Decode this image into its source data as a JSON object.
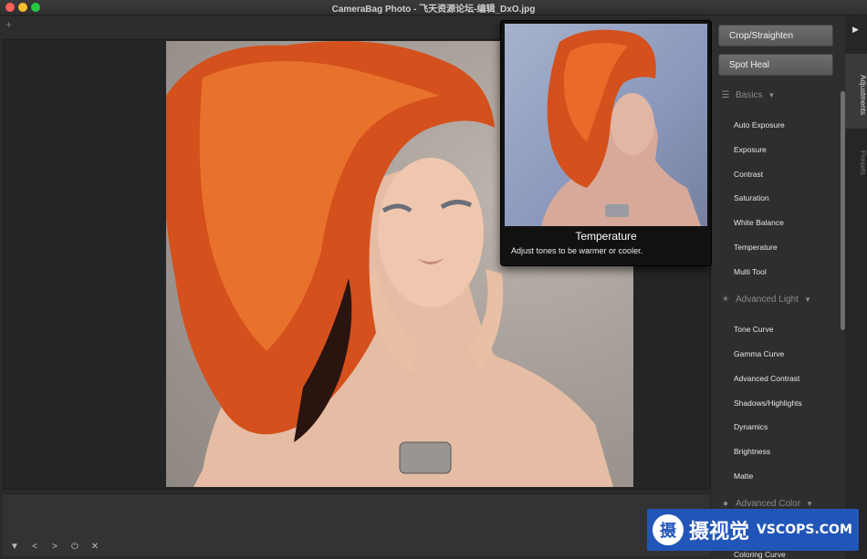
{
  "window": {
    "title": "CameraBag Photo - 飞天资源论坛-编辑_DxO.jpg"
  },
  "toolbar": {
    "add_tab": "+"
  },
  "tooltip": {
    "title": "Temperature",
    "description": "Adjust tones to be warmer or cooler."
  },
  "panel": {
    "crop_label": "Crop/Straighten",
    "spot_heal_label": "Spot Heal",
    "sections": {
      "basics": {
        "title": "Basics",
        "items": [
          "Auto Exposure",
          "Exposure",
          "Contrast",
          "Saturation",
          "White Balance",
          "Temperature",
          "Multi Tool"
        ]
      },
      "advanced_light": {
        "title": "Advanced Light",
        "items": [
          "Tone Curve",
          "Gamma Curve",
          "Advanced Contrast",
          "Shadows/Highlights",
          "Dynamics",
          "Brightness",
          "Matte"
        ]
      },
      "advanced_color": {
        "title": "Advanced Color",
        "items": [
          "Coloring Curve"
        ]
      }
    }
  },
  "sidetabs": {
    "adjustments": "Adjustments",
    "presets": "Presets"
  },
  "bottom_controls": {
    "collapse": "▼",
    "prev": "<",
    "next": ">",
    "power": "⏻",
    "close": "✕"
  },
  "watermark": {
    "logo_char": "摄",
    "cn_text": "摄视觉",
    "domain": "VSCOPS.COM"
  },
  "colors": {
    "accent_blue": "#2156b8",
    "hair": "#d4501c",
    "panel_bg": "#2e2e2e"
  }
}
